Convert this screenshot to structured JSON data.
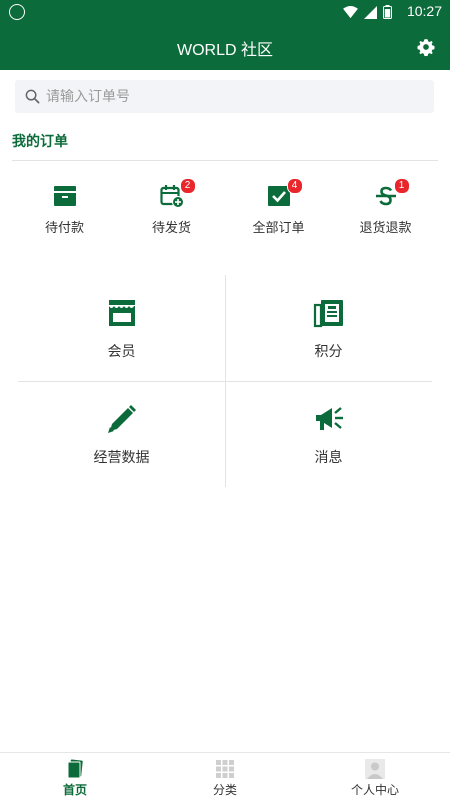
{
  "status_bar": {
    "time": "10:27"
  },
  "header": {
    "title": "WORLD 社区"
  },
  "search": {
    "placeholder": "请输入订单号"
  },
  "orders": {
    "title": "我的订单",
    "items": [
      {
        "label": "待付款",
        "icon": "wallet-icon",
        "badge": ""
      },
      {
        "label": "待发货",
        "icon": "calendar-add-icon",
        "badge": "2"
      },
      {
        "label": "全部订单",
        "icon": "check-box-icon",
        "badge": "4"
      },
      {
        "label": "退货退款",
        "icon": "refund-icon",
        "badge": "1"
      }
    ]
  },
  "grid": {
    "items": [
      {
        "label": "会员",
        "icon": "store-icon"
      },
      {
        "label": "积分",
        "icon": "newspaper-icon"
      },
      {
        "label": "经营数据",
        "icon": "pencil-icon"
      },
      {
        "label": "消息",
        "icon": "megaphone-icon"
      }
    ]
  },
  "tabbar": {
    "items": [
      {
        "label": "首页",
        "icon": "home-icon",
        "active": true
      },
      {
        "label": "分类",
        "icon": "grid-icon",
        "active": false
      },
      {
        "label": "个人中心",
        "icon": "user-icon",
        "active": false
      }
    ]
  },
  "colors": {
    "brand": "#0c6b3a",
    "badge": "#e8262c"
  }
}
